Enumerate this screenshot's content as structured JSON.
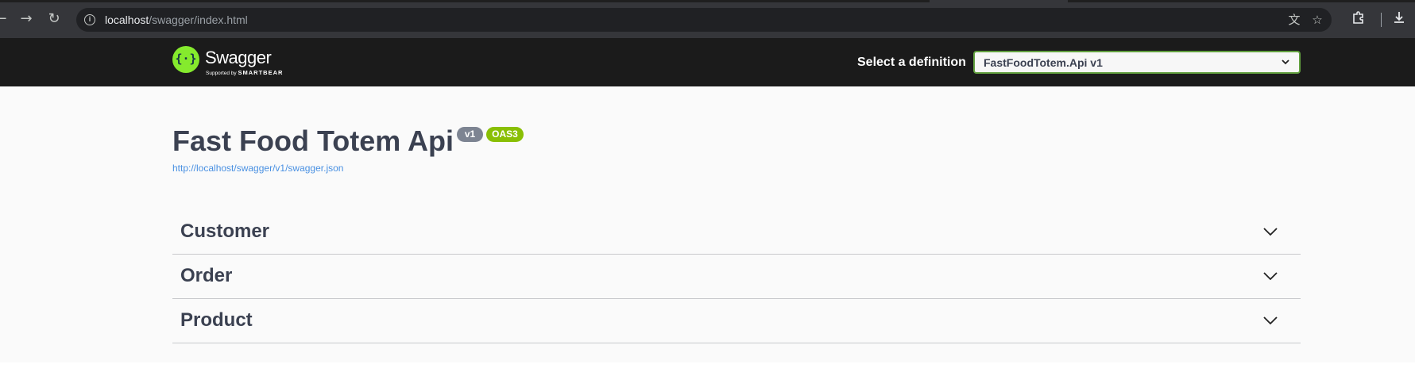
{
  "browser": {
    "url_host": "localhost",
    "url_path": "/swagger/index.html",
    "icons": [
      "back-icon",
      "forward-icon",
      "reload-icon",
      "site-info-icon",
      "translate-icon",
      "bookmark-star-icon",
      "extensions-icon",
      "downloads-icon"
    ]
  },
  "topbar": {
    "brand": "Swagger",
    "brand_sub_prefix": "Supported by",
    "brand_sub_company": "SMARTBEAR",
    "select_label": "Select a definition",
    "selected_definition": "FastFoodTotem.Api v1"
  },
  "info": {
    "title": "Fast Food Totem Api",
    "version_badge": "v1",
    "oas_badge": "OAS3",
    "spec_url": "http://localhost/swagger/v1/swagger.json"
  },
  "tags": [
    {
      "name": "Customer"
    },
    {
      "name": "Order"
    },
    {
      "name": "Product"
    }
  ],
  "colors": {
    "topbar_bg": "#1b1b1b",
    "select_border": "#62a03f",
    "logo_green": "#85ea2d",
    "version_badge": "#7d8492",
    "oas_badge": "#89bf04",
    "link": "#4990e2",
    "text": "#3b4151"
  }
}
